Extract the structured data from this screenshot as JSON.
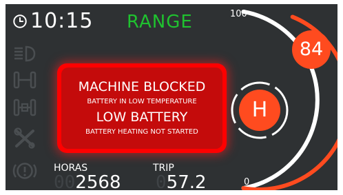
{
  "header": {
    "time": "10:15",
    "mode": "RANGE",
    "mode_color": "#1fc22f"
  },
  "sidebar": {
    "icons": [
      {
        "name": "headlight-icon"
      },
      {
        "name": "axle-icon"
      },
      {
        "name": "axle-lock-icon"
      },
      {
        "name": "tools-icon"
      },
      {
        "name": "brake-warning-icon"
      }
    ]
  },
  "alert": {
    "title": "MACHINE BLOCKED",
    "subtitle": "BATTERY IN LOW TEMPERATURE",
    "title2": "LOW BATTERY",
    "subtitle2": "BATTERY HEATING NOT STARTED",
    "color": "#c40b0b"
  },
  "hours": {
    "label": "HORAS",
    "ghost": "00",
    "value": "2568"
  },
  "trip": {
    "label": "TRIP",
    "ghost": "0",
    "value": "57.2"
  },
  "battery_gauge": {
    "max_label": "100",
    "min_label": "0",
    "level": 84,
    "level_text": "84",
    "accent": "#ff4b1f"
  },
  "indicator": {
    "letter": "H"
  }
}
